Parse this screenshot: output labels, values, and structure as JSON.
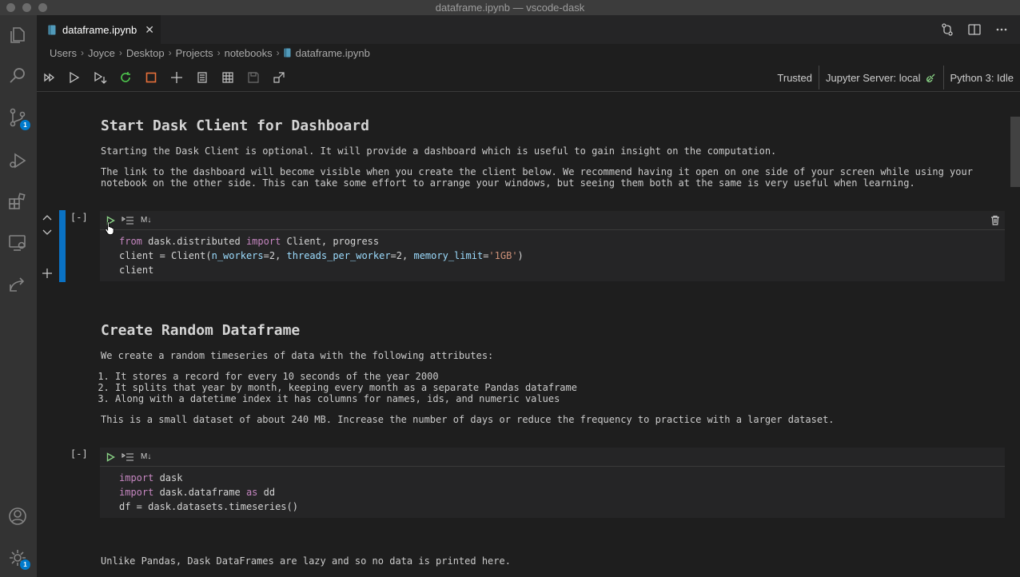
{
  "window": {
    "title": "dataframe.ipynb — vscode-dask"
  },
  "activity_bar": {
    "source_control_badge": "1",
    "settings_badge": "1"
  },
  "tab": {
    "filename": "dataframe.ipynb",
    "close_glyph": "✕"
  },
  "breadcrumb": {
    "items": [
      "Users",
      "Joyce",
      "Desktop",
      "Projects",
      "notebooks"
    ],
    "file": "dataframe.ipynb",
    "separator": "›"
  },
  "toolbar": {
    "trusted": "Trusted",
    "server": "Jupyter Server: local",
    "kernel": "Python 3: Idle"
  },
  "md1": {
    "heading": "Start Dask Client for Dashboard",
    "p1": "Starting the Dask Client is optional. It will provide a dashboard which is useful to gain insight on the computation.",
    "p2a": "The link to the dashboard will become visible when you create the client below. We recommend having it open on one side of your screen while using your",
    "p2b": "notebook on the other side. This can take some effort to arrange your windows, but seeing them both at the same is very useful when learning."
  },
  "cell1": {
    "exec": "[-]",
    "md_label": "M↓",
    "l1": {
      "kw1": "from",
      "t1": " dask.distributed ",
      "kw2": "import",
      "t2": " Client, progress"
    },
    "l2": {
      "t1": "client = Client(",
      "p1": "n_workers",
      "v1": "=2, ",
      "p2": "threads_per_worker",
      "v2": "=2, ",
      "p3": "memory_limit",
      "eq": "=",
      "s": "'1GB'",
      "end": ")"
    },
    "l3": "client"
  },
  "md2": {
    "heading": "Create Random Dataframe",
    "p1": "We create a random timeseries of data with the following attributes:",
    "items": [
      "It stores a record for every 10 seconds of the year 2000",
      "It splits that year by month, keeping every month as a separate Pandas dataframe",
      "Along with a datetime index it has columns for names, ids, and numeric values"
    ],
    "p2": "This is a small dataset of about 240 MB. Increase the number of days or reduce the frequency to practice with a larger dataset."
  },
  "cell2": {
    "exec": "[-]",
    "md_label": "M↓",
    "l1": {
      "kw": "import",
      "t": " dask"
    },
    "l2": {
      "kw1": "import",
      "t1": " dask.dataframe ",
      "kw2": "as",
      "t2": " dd"
    },
    "l3": "df = dask.datasets.timeseries()"
  },
  "md3": {
    "p1": "Unlike Pandas, Dask DataFrames are lazy and so no data is printed here."
  },
  "colors": {
    "accent": "#007acc",
    "run_green": "#89d185",
    "restart_green": "#4ec94e",
    "interrupt_orange": "#e8703a"
  }
}
